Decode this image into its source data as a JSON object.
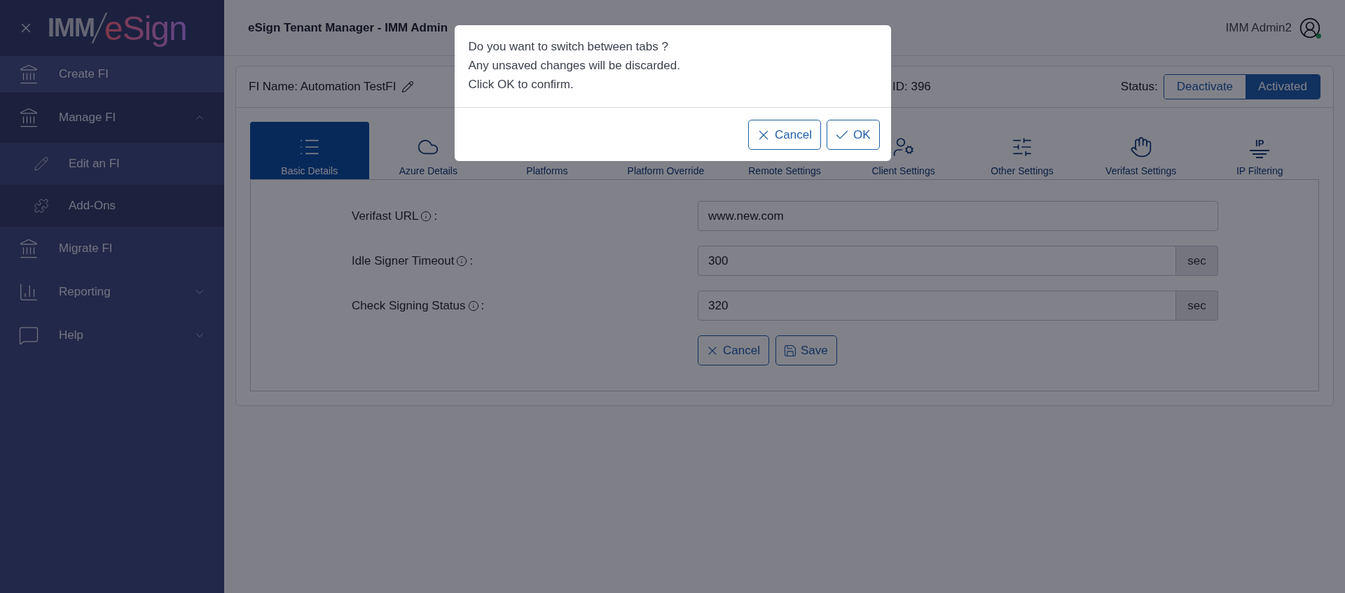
{
  "sidebar": {
    "logo": {
      "prefix": "IMM",
      "name": "eSign"
    },
    "items": [
      {
        "label": "Create FI"
      },
      {
        "label": "Manage FI",
        "expanded": true,
        "children": [
          {
            "label": "Edit an FI",
            "selected": true
          },
          {
            "label": "Add-Ons",
            "selected": false
          }
        ]
      },
      {
        "label": "Migrate FI"
      },
      {
        "label": "Reporting",
        "expanded": false
      },
      {
        "label": "Help",
        "expanded": false
      }
    ]
  },
  "header": {
    "title": "eSign Tenant Manager - IMM Admin",
    "user": "IMM Admin2",
    "online": true
  },
  "fi_bar": {
    "name_label": "FI Name: Automation TestFI",
    "id_label": "ID: 396",
    "status_label": "Status:",
    "status_options": [
      {
        "label": "Deactivate",
        "selected": false
      },
      {
        "label": "Activated",
        "selected": true
      }
    ]
  },
  "tabs": [
    {
      "label": "Basic Details",
      "selected": true
    },
    {
      "label": "Azure Details",
      "selected": false
    },
    {
      "label": "Platforms",
      "selected": false
    },
    {
      "label": "Platform Override",
      "selected": false
    },
    {
      "label": "Remote Settings",
      "selected": false
    },
    {
      "label": "Client Settings",
      "selected": false
    },
    {
      "label": "Other Settings",
      "selected": false
    },
    {
      "label": "Verifast Settings",
      "selected": false
    },
    {
      "label": "IP Filtering",
      "selected": false,
      "icon_text": "IP"
    }
  ],
  "form": {
    "fields": [
      {
        "label": "Verifast URL",
        "value": "www.new.com"
      },
      {
        "label": "Idle Signer Timeout",
        "value": "300",
        "unit": "sec"
      },
      {
        "label": "Check Signing Status",
        "value": "320",
        "unit": "sec"
      }
    ],
    "label_suffix": ":",
    "buttons": [
      {
        "kind": "cancel",
        "label": "Cancel"
      },
      {
        "kind": "save",
        "label": "Save"
      }
    ]
  },
  "dialog": {
    "lines": [
      "Do you want to switch between tabs ?",
      "Any unsaved changes will be discarded.",
      "Click OK to confirm."
    ],
    "buttons": [
      {
        "kind": "cancel",
        "label": "Cancel"
      },
      {
        "kind": "ok",
        "label": "OK"
      }
    ]
  }
}
